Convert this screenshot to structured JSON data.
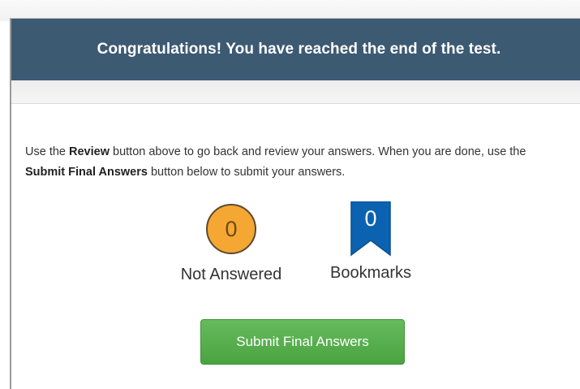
{
  "header": {
    "title": "Congratulations! You have reached the end of the test."
  },
  "instructions": {
    "part1": "Use the ",
    "review_bold": "Review",
    "part2": " button above to go back and review your answers. When you are done, use the ",
    "submit_bold": "Submit Final Answers",
    "part3": " button below to submit your answers."
  },
  "stats": {
    "not_answered": {
      "count": "0",
      "label": "Not Answered",
      "color": "#f5a733"
    },
    "bookmarks": {
      "count": "0",
      "label": "Bookmarks",
      "color": "#0b62b0"
    }
  },
  "submit_button": {
    "label": "Submit Final Answers",
    "color": "#5ab150"
  },
  "icons": {
    "not_answered": "orange-circle-icon",
    "bookmarks": "bookmark-ribbon-icon"
  }
}
